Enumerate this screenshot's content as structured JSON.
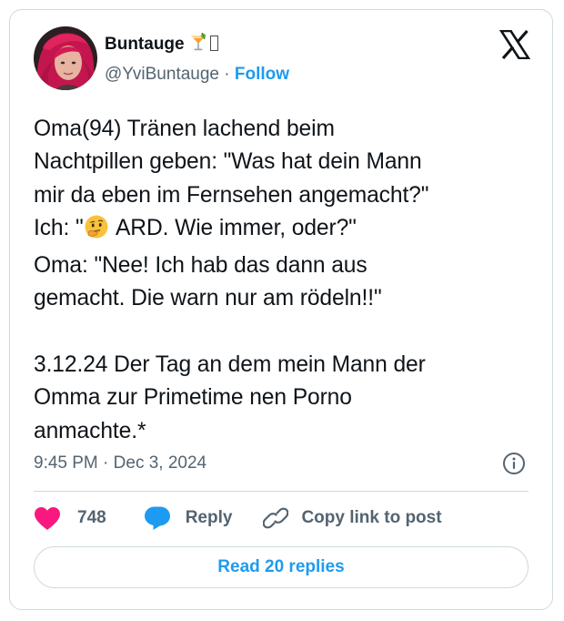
{
  "author": {
    "display_name": "Buntauge",
    "handle": "@YviBuntauge",
    "separator": "·",
    "follow_label": "Follow",
    "name_emoji": "cocktail-glass-icon",
    "name_box_glyph": "missing-glyph-icon"
  },
  "tweet": {
    "line1": "Oma(94) Tränen lachend beim",
    "line2": "Nachtpillen geben: \"Was hat dein Mann",
    "line3": "mir da eben im Fernsehen angemacht?\"",
    "line4_prefix": "Ich: \"",
    "line4_emoji": "thinking-face-icon",
    "line4_suffix": " ARD. Wie immer, oder?\"",
    "line5": "Oma: \"Nee! Ich hab das dann aus",
    "line6": "gemacht. Die warn nur am rödeln!!\"",
    "line7": "",
    "line8": "3.12.24 Der Tag an dem mein Mann der",
    "line9": "Omma zur Primetime nen Porno",
    "line10": "anmachte.*"
  },
  "meta": {
    "time": "9:45 PM",
    "separator": "·",
    "date": "Dec 3, 2024"
  },
  "actions": {
    "like_count": "748",
    "reply_label": "Reply",
    "copy_link_label": "Copy link to post"
  },
  "read_replies_label": "Read 20 replies",
  "colors": {
    "accent": "#1d9bf0",
    "like": "#f91880",
    "text": "#0f1419",
    "secondary": "#536471",
    "border": "#cfd9de"
  }
}
